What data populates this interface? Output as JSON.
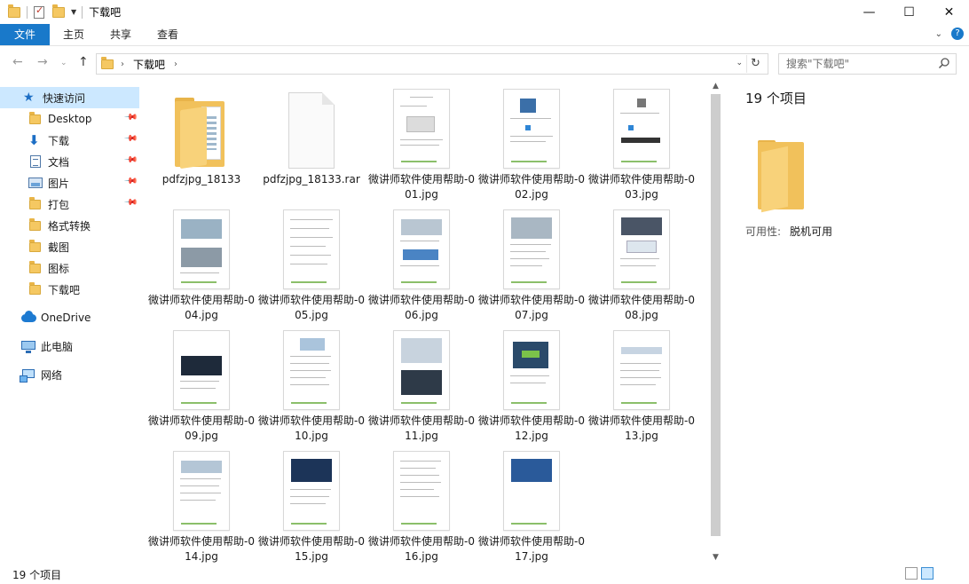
{
  "window": {
    "title": "下载吧",
    "minimize": "—",
    "maximize": "☐",
    "close": "✕"
  },
  "ribbon": {
    "tabs": [
      {
        "label": "文件"
      },
      {
        "label": "主页"
      },
      {
        "label": "共享"
      },
      {
        "label": "查看"
      }
    ]
  },
  "address": {
    "path": "下载吧",
    "search_placeholder": "搜索\"下载吧\""
  },
  "nav": {
    "items": [
      {
        "label": "快速访问",
        "icon": "star-icon",
        "selected": true
      },
      {
        "label": "Desktop",
        "icon": "folder-icon",
        "pinned": true
      },
      {
        "label": "下载",
        "icon": "download-arrow-icon",
        "pinned": true
      },
      {
        "label": "文档",
        "icon": "document-icon",
        "pinned": true
      },
      {
        "label": "图片",
        "icon": "pictures-icon",
        "pinned": true
      },
      {
        "label": "打包",
        "icon": "folder-icon",
        "pinned": true
      },
      {
        "label": "格式转换",
        "icon": "folder-icon"
      },
      {
        "label": "截图",
        "icon": "folder-icon"
      },
      {
        "label": "图标",
        "icon": "folder-icon"
      },
      {
        "label": "下载吧",
        "icon": "folder-icon"
      },
      {
        "label": "OneDrive",
        "icon": "onedrive-cloud-icon"
      },
      {
        "label": "此电脑",
        "icon": "this-pc-icon"
      },
      {
        "label": "网络",
        "icon": "network-icon"
      }
    ]
  },
  "files": [
    {
      "name": "pdfzjpg_18133",
      "kind": "folder"
    },
    {
      "name": "pdfzjpg_18133.rar",
      "kind": "rar"
    },
    {
      "name": "微讲师软件使用帮助-001.jpg",
      "kind": "jpg"
    },
    {
      "name": "微讲师软件使用帮助-002.jpg",
      "kind": "jpg"
    },
    {
      "name": "微讲师软件使用帮助-003.jpg",
      "kind": "jpg"
    },
    {
      "name": "微讲师软件使用帮助-004.jpg",
      "kind": "jpg"
    },
    {
      "name": "微讲师软件使用帮助-005.jpg",
      "kind": "jpg"
    },
    {
      "name": "微讲师软件使用帮助-006.jpg",
      "kind": "jpg"
    },
    {
      "name": "微讲师软件使用帮助-007.jpg",
      "kind": "jpg"
    },
    {
      "name": "微讲师软件使用帮助-008.jpg",
      "kind": "jpg"
    },
    {
      "name": "微讲师软件使用帮助-009.jpg",
      "kind": "jpg"
    },
    {
      "name": "微讲师软件使用帮助-010.jpg",
      "kind": "jpg"
    },
    {
      "name": "微讲师软件使用帮助-011.jpg",
      "kind": "jpg"
    },
    {
      "name": "微讲师软件使用帮助-012.jpg",
      "kind": "jpg"
    },
    {
      "name": "微讲师软件使用帮助-013.jpg",
      "kind": "jpg"
    },
    {
      "name": "微讲师软件使用帮助-014.jpg",
      "kind": "jpg"
    },
    {
      "name": "微讲师软件使用帮助-015.jpg",
      "kind": "jpg"
    },
    {
      "name": "微讲师软件使用帮助-016.jpg",
      "kind": "jpg"
    },
    {
      "name": "微讲师软件使用帮助-017.jpg",
      "kind": "jpg"
    }
  ],
  "details": {
    "count": "19 个项目",
    "availability_label": "可用性:",
    "availability_value": "脱机可用"
  },
  "status": {
    "text": "19 个项目"
  },
  "colors": {
    "accent": "#1979ca",
    "selection": "#cce8ff",
    "folder": "#f1c15b"
  }
}
